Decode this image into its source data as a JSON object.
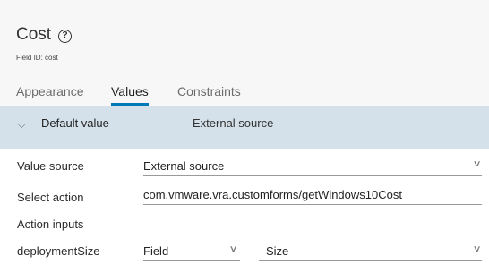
{
  "header": {
    "title": "Cost",
    "field_id": "Field ID: cost"
  },
  "tabs": [
    {
      "label": "Appearance",
      "active": false
    },
    {
      "label": "Values",
      "active": true
    },
    {
      "label": "Constraints",
      "active": false
    }
  ],
  "section": {
    "title": "Default value",
    "value": "External source",
    "expanded": true
  },
  "form": {
    "value_source": {
      "label": "Value source",
      "value": "External source"
    },
    "select_action": {
      "label": "Select action",
      "value": "com.vmware.vra.customforms/getWindows10Cost"
    },
    "action_inputs_label": "Action inputs",
    "inputs": [
      {
        "name": "deploymentSize",
        "type": "Field",
        "value": "Size"
      }
    ]
  },
  "colors": {
    "accent": "#0079b8",
    "section_bg": "#d4e1ea",
    "header_bg": "#f7f7f7"
  },
  "icons": {
    "help": "help-circle-icon",
    "collapse": "chevron-down-icon",
    "dropdown": "chevron-down-icon"
  }
}
